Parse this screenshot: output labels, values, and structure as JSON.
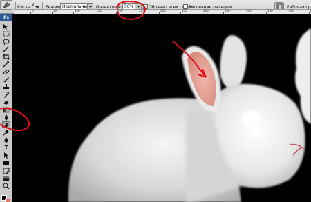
{
  "options_bar": {
    "brush_label": "Кисть:",
    "brush_size": "9",
    "mode_label": "Режим:",
    "mode_value": "Нормальный",
    "strength_label": "Интенсивность:",
    "strength_value": "50%",
    "sample_all_layers_label": "Образец всех слоев",
    "finger_painting_label": "Рисование пальцем",
    "workspace_label": "Рабочая среда"
  },
  "ruler": {
    "labels": [
      "0",
      "50",
      "100",
      "150",
      "200",
      "250",
      "300",
      "350",
      "400",
      "450",
      "500",
      "550",
      "600",
      "650"
    ]
  },
  "toolbox": {
    "logo": "Ps",
    "type_tool_glyph": "T"
  },
  "colors": {
    "annotation_red": "#e0101a",
    "foreground": "#000000",
    "background": "#e07a61",
    "ear_inner": "#e6a79c"
  }
}
